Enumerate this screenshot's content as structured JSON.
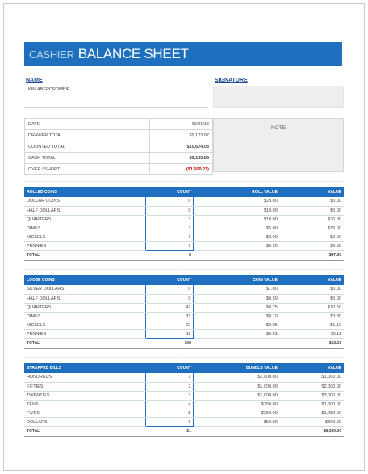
{
  "header": {
    "title_prefix": "CASHIER",
    "title_main": "BALANCE SHEET"
  },
  "name_label": "NAME",
  "name_value": "KIM ABERCROMBIE",
  "signature_label": "SIGNATURE",
  "info": [
    {
      "label": "DATE",
      "value": "06/01/13"
    },
    {
      "label": "DRAWER TOTAL",
      "value": "$9,123.87"
    },
    {
      "label": "COUNTED TOTAL",
      "value": "$10,624.08"
    },
    {
      "label": "CASH TOTAL",
      "value": "$9,130.86"
    },
    {
      "label": "OVER / SHORT",
      "value": "($1,500.21)"
    }
  ],
  "note_label": "NOTE",
  "rolled": {
    "headers": [
      "ROLLED COINS",
      "COUNT",
      "ROLL VALUE",
      "VALUE"
    ],
    "rows": [
      [
        "DOLLAR COINS",
        "0",
        "$25.00",
        "$0.00"
      ],
      [
        "HALF DOLLARS",
        "0",
        "$10.00",
        "$0.00"
      ],
      [
        "QUARTERS",
        "3",
        "$10.00",
        "$30.00"
      ],
      [
        "DIMES",
        "3",
        "$5.00",
        "$15.00"
      ],
      [
        "NICKELS",
        "1",
        "$2.00",
        "$2.00"
      ],
      [
        "PENNIES",
        "1",
        "$0.50",
        "$0.50"
      ]
    ],
    "total": [
      "TOTAL",
      "8",
      "",
      "$47.50"
    ]
  },
  "loose": {
    "headers": [
      "LOOSE COINS",
      "COUNT",
      "COIN VALUE",
      "VALUE"
    ],
    "rows": [
      [
        "SILVER DOLLARS",
        "0",
        "$1.00",
        "$0.00"
      ],
      [
        "HALF DOLLARS",
        "0",
        "$0.50",
        "$0.00"
      ],
      [
        "QUARTERS",
        "42",
        "$0.25",
        "$10.50"
      ],
      [
        "DIMES",
        "33",
        "$0.10",
        "$3.30"
      ],
      [
        "NICKELS",
        "22",
        "$0.05",
        "$1.10"
      ],
      [
        "PENNIES",
        "11",
        "$0.01",
        "$0.11"
      ]
    ],
    "total": [
      "TOTAL",
      "108",
      "",
      "$15.01"
    ]
  },
  "bills": {
    "headers": [
      "STRAPPED BILLS",
      "COUNT",
      "BUNDLE VALUE",
      "VALUE"
    ],
    "rows": [
      [
        "HUNDREDS",
        "1",
        "$1,000.00",
        "$1,000.00"
      ],
      [
        "FIFTIES",
        "2",
        "$1,000.00",
        "$2,000.00"
      ],
      [
        "TWENTIES",
        "3",
        "$1,000.00",
        "$3,000.00"
      ],
      [
        "TENS",
        "4",
        "$250.00",
        "$1,000.00"
      ],
      [
        "FIVES",
        "5",
        "$250.00",
        "$1,250.00"
      ],
      [
        "DOLLARS",
        "6",
        "$50.00",
        "$300.00"
      ]
    ],
    "total": [
      "TOTAL",
      "21",
      "",
      "$8,550.00"
    ]
  }
}
